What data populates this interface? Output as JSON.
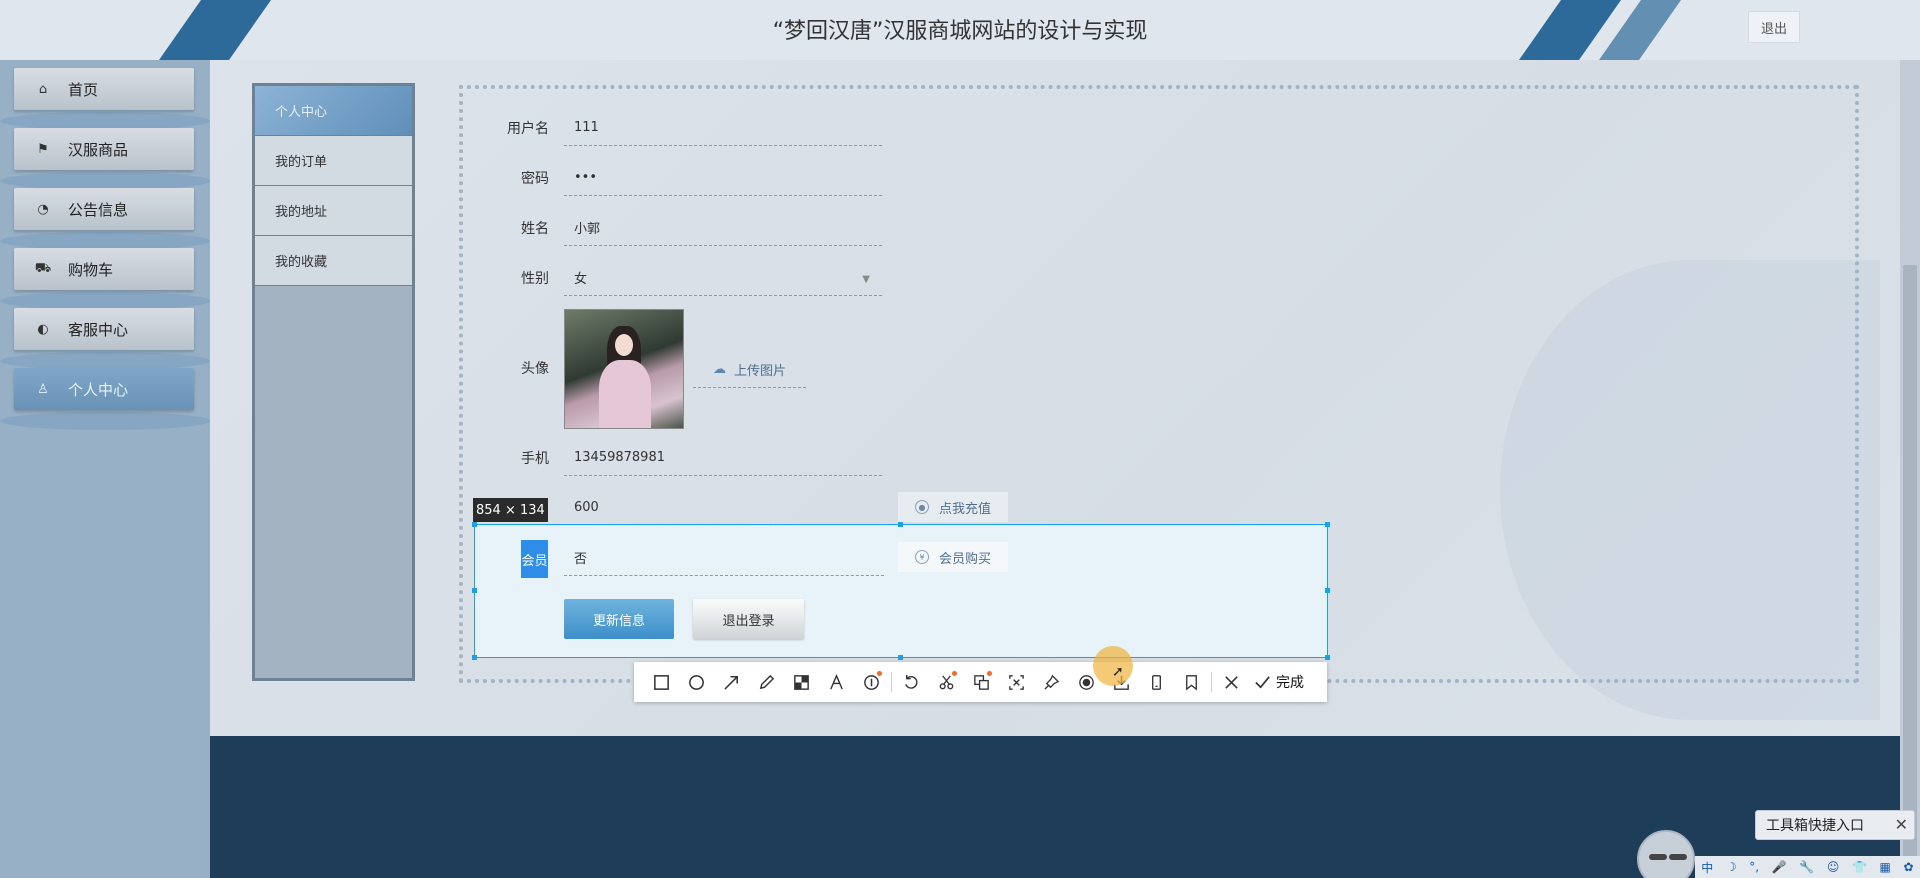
{
  "header": {
    "title": "“梦回汉唐”汉服商城网站的设计与实现",
    "logout": "退出"
  },
  "leftnav": {
    "items": [
      {
        "label": "首页",
        "icon": "home-icon"
      },
      {
        "label": "汉服商品",
        "icon": "flag-icon"
      },
      {
        "label": "公告信息",
        "icon": "gauge-icon"
      },
      {
        "label": "购物车",
        "icon": "cart-icon"
      },
      {
        "label": "客服中心",
        "icon": "chat-icon"
      },
      {
        "label": "个人中心",
        "icon": "user-icon",
        "active": true
      }
    ]
  },
  "user_menu": {
    "items": [
      {
        "label": "个人中心",
        "active": true
      },
      {
        "label": "我的订单"
      },
      {
        "label": "我的地址"
      },
      {
        "label": "我的收藏"
      }
    ]
  },
  "form": {
    "username": {
      "label": "用户名",
      "value": "111"
    },
    "password": {
      "label": "密码",
      "value": "•••"
    },
    "name": {
      "label": "姓名",
      "value": "小郭"
    },
    "gender": {
      "label": "性别",
      "value": "女"
    },
    "avatar": {
      "label": "头像",
      "upload": "上传图片"
    },
    "phone": {
      "label": "手机",
      "value": "13459878981"
    },
    "balance": {
      "value": "600",
      "action": "点我充值"
    },
    "member": {
      "label": "会员",
      "value": "否",
      "action": "会员购买"
    },
    "update_button": "更新信息",
    "logout_button": "退出登录"
  },
  "capture": {
    "dimensions": "854 × 134",
    "done": "完成",
    "tools": [
      "rect-icon",
      "ellipse-icon",
      "arrow-icon",
      "pen-icon",
      "mosaic-icon",
      "text-icon",
      "number-icon",
      "undo-icon",
      "crop-icon",
      "translate-icon",
      "ocr-icon",
      "pin-icon",
      "record-icon",
      "save-icon",
      "phone-icon",
      "bookmark-icon",
      "close-icon",
      "check-icon"
    ],
    "accent": "#1aa2e6"
  },
  "widgets": {
    "toolbox": "工具箱快捷入口",
    "ime": [
      "中",
      "☽",
      "°,",
      "🎤",
      "🔧",
      "☺",
      "👕",
      "▦",
      "✿"
    ]
  }
}
